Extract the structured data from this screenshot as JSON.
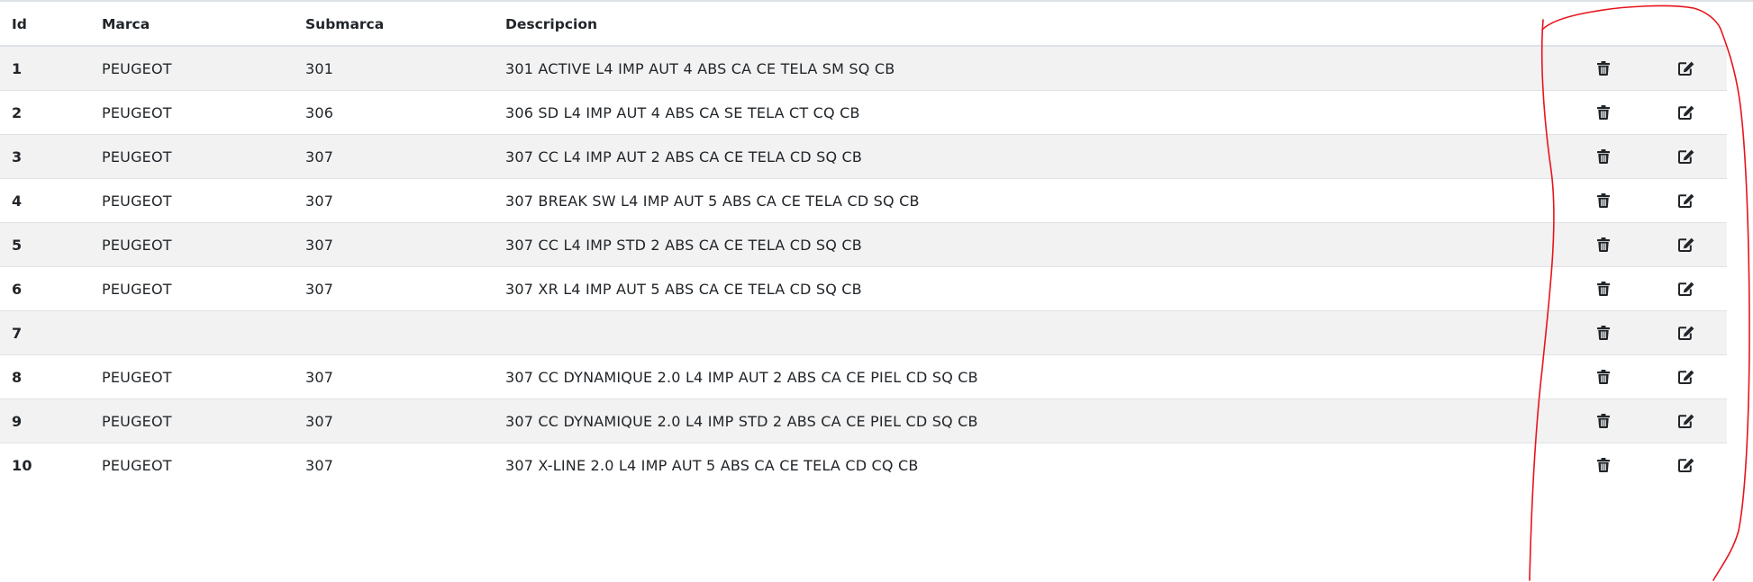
{
  "table": {
    "headers": {
      "id": "Id",
      "marca": "Marca",
      "submarca": "Submarca",
      "descripcion": "Descripcion"
    },
    "rows": [
      {
        "id": "1",
        "marca": "PEUGEOT",
        "submarca": "301",
        "descripcion": "301 ACTIVE L4 IMP AUT 4 ABS CA CE TELA SM SQ CB"
      },
      {
        "id": "2",
        "marca": "PEUGEOT",
        "submarca": "306",
        "descripcion": "306 SD L4 IMP AUT 4 ABS CA SE TELA CT CQ CB"
      },
      {
        "id": "3",
        "marca": "PEUGEOT",
        "submarca": "307",
        "descripcion": "307 CC L4 IMP AUT 2 ABS CA CE TELA CD SQ CB"
      },
      {
        "id": "4",
        "marca": "PEUGEOT",
        "submarca": "307",
        "descripcion": "307 BREAK SW L4 IMP AUT 5 ABS CA CE TELA CD SQ CB"
      },
      {
        "id": "5",
        "marca": "PEUGEOT",
        "submarca": "307",
        "descripcion": "307 CC L4 IMP STD 2 ABS CA CE TELA CD SQ CB"
      },
      {
        "id": "6",
        "marca": "PEUGEOT",
        "submarca": "307",
        "descripcion": "307 XR L4 IMP AUT 5 ABS CA CE TELA CD SQ CB"
      },
      {
        "id": "7",
        "marca": "",
        "submarca": "",
        "descripcion": ""
      },
      {
        "id": "8",
        "marca": "PEUGEOT",
        "submarca": "307",
        "descripcion": "307 CC DYNAMIQUE 2.0 L4 IMP AUT 2 ABS CA CE PIEL CD SQ CB"
      },
      {
        "id": "9",
        "marca": "PEUGEOT",
        "submarca": "307",
        "descripcion": "307 CC DYNAMIQUE 2.0 L4 IMP STD 2 ABS CA CE PIEL CD SQ CB"
      },
      {
        "id": "10",
        "marca": "PEUGEOT",
        "submarca": "307",
        "descripcion": "307 X-LINE 2.0 L4 IMP AUT 5 ABS CA CE TELA CD CQ CB"
      }
    ],
    "actions": {
      "delete_icon": "trash-icon",
      "edit_icon": "edit-icon"
    }
  },
  "colors": {
    "striped_row": "#f2f2f2",
    "border": "#dee2e6",
    "text": "#212529",
    "annotation": "#e8141c"
  }
}
